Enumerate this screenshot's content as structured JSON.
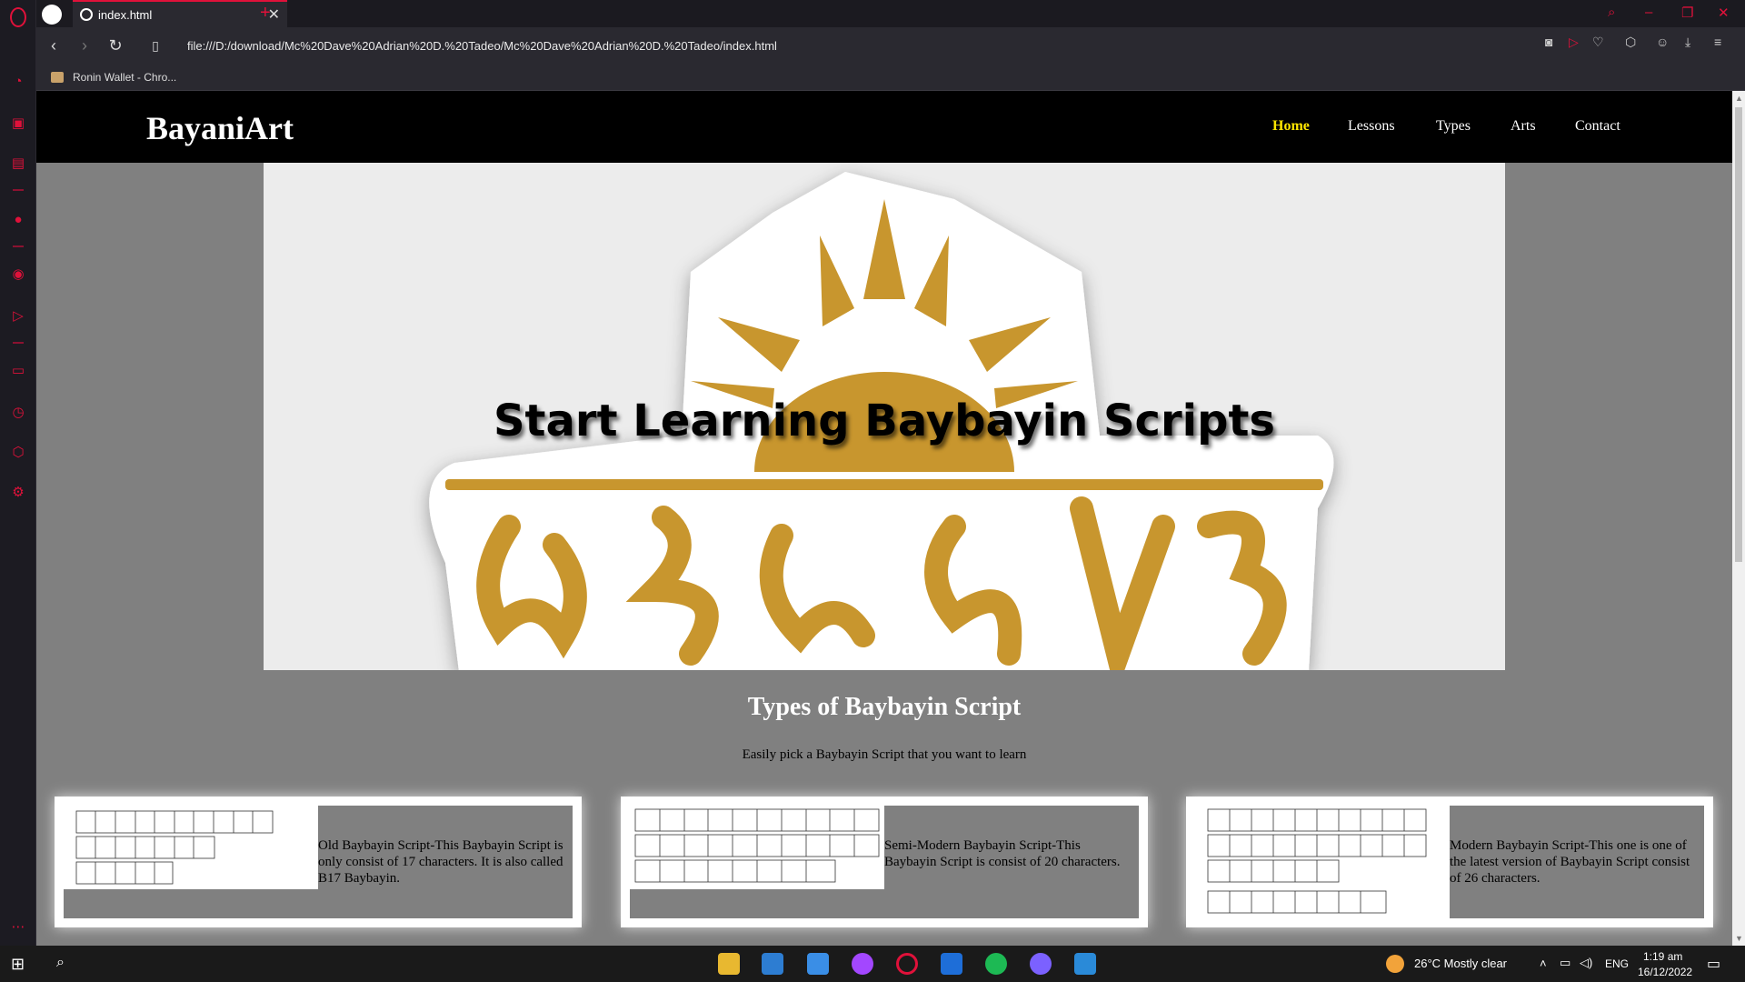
{
  "browser": {
    "tab_title": "index.html",
    "url": "file:///D:/download/Mc%20Dave%20Adrian%20D.%20Tadeo/Mc%20Dave%20Adrian%20D.%20Tadeo/index.html",
    "bookmark": "Ronin Wallet - Chro...",
    "accent": "#e0113a"
  },
  "site": {
    "logo": "BayaniArt",
    "nav": [
      "Home",
      "Lessons",
      "Types",
      "Arts",
      "Contact"
    ],
    "active_nav": "Home",
    "hero_title": "Start Learning Baybayin Scripts",
    "section_title": "Types of Baybayin Script",
    "section_subtitle": "Easily pick a Baybayin Script that you want to learn",
    "cards": [
      {
        "description": "Old Baybayin Script-This Baybayin Script is only consist of 17 characters. It is also called B17 Baybayin."
      },
      {
        "description": "Semi-Modern Baybayin Script-This Baybayin Script is consist of 20 characters."
      },
      {
        "description": "Modern Baybayin Script-This one is one of the latest version of Baybayin Script consist of 26 characters."
      }
    ],
    "colors": {
      "gold": "#c8962e",
      "nav_active": "#ffe600",
      "page_bg": "#808080"
    }
  },
  "taskbar": {
    "weather": "26°C  Mostly clear",
    "language": "ENG",
    "time": "1:19 am",
    "date": "16/12/2022"
  }
}
